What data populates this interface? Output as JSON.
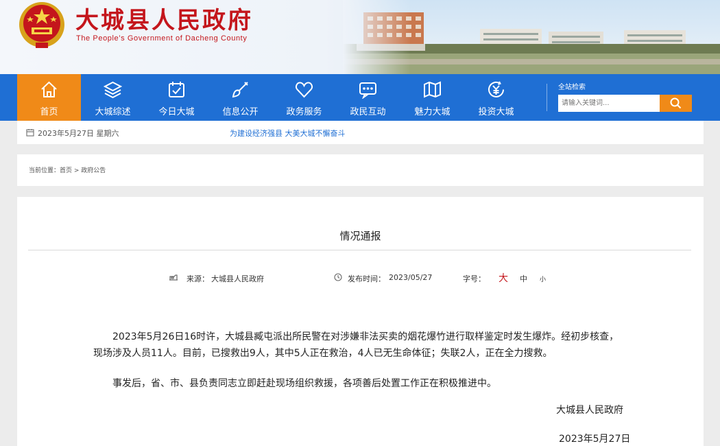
{
  "header": {
    "title": "大城县人民政府",
    "subtitle": "The People’s Government of Dacheng County",
    "emblem_icon": "national-emblem-icon"
  },
  "nav": {
    "items": [
      {
        "label": "首页",
        "icon": "home-icon",
        "active": true
      },
      {
        "label": "大城综述",
        "icon": "layers-icon"
      },
      {
        "label": "今日大城",
        "icon": "calendar-check-icon"
      },
      {
        "label": "信息公开",
        "icon": "brush-icon"
      },
      {
        "label": "政务服务",
        "icon": "heart-icon"
      },
      {
        "label": "政民互动",
        "icon": "chat-icon"
      },
      {
        "label": "魅力大城",
        "icon": "map-icon"
      },
      {
        "label": "投资大城",
        "icon": "yuan-icon"
      }
    ],
    "search_title": "全站检索",
    "search_placeholder": "请输入关键词..."
  },
  "infobar": {
    "date": "2023年5月27日 星期六",
    "slogan": "为建设经济强县  大美大城不懈奋斗"
  },
  "breadcrumb": {
    "prefix": "当前位置：",
    "home": "首页",
    "sep": " > ",
    "current": "政府公告"
  },
  "article": {
    "title": "情况通报",
    "source_label": "来源：",
    "source": "大城县人民政府",
    "time_label": "发布时间：",
    "time": "2023/05/27",
    "font_label": "字号：",
    "size_large": "大",
    "size_medium": "中",
    "size_small": "小",
    "paragraphs": [
      "2023年5月26日16时许，大城县臧屯派出所民警在对涉嫌非法买卖的烟花爆竹进行取样鉴定时发生爆炸。经初步核查，现场涉及人员11人。目前，已搜救出9人，其中5人正在救治，4人已无生命体征；失联2人，正在全力搜救。",
      "事发后，省、市、县负责同志立即赶赴现场组织救援，各项善后处置工作正在积极推进中。"
    ],
    "signature": "大城县人民政府",
    "sign_date": "2023年5月27日"
  },
  "colors": {
    "brand_red": "#c4161c",
    "nav_blue": "#1f6fd4",
    "accent_orange": "#f08a18"
  }
}
